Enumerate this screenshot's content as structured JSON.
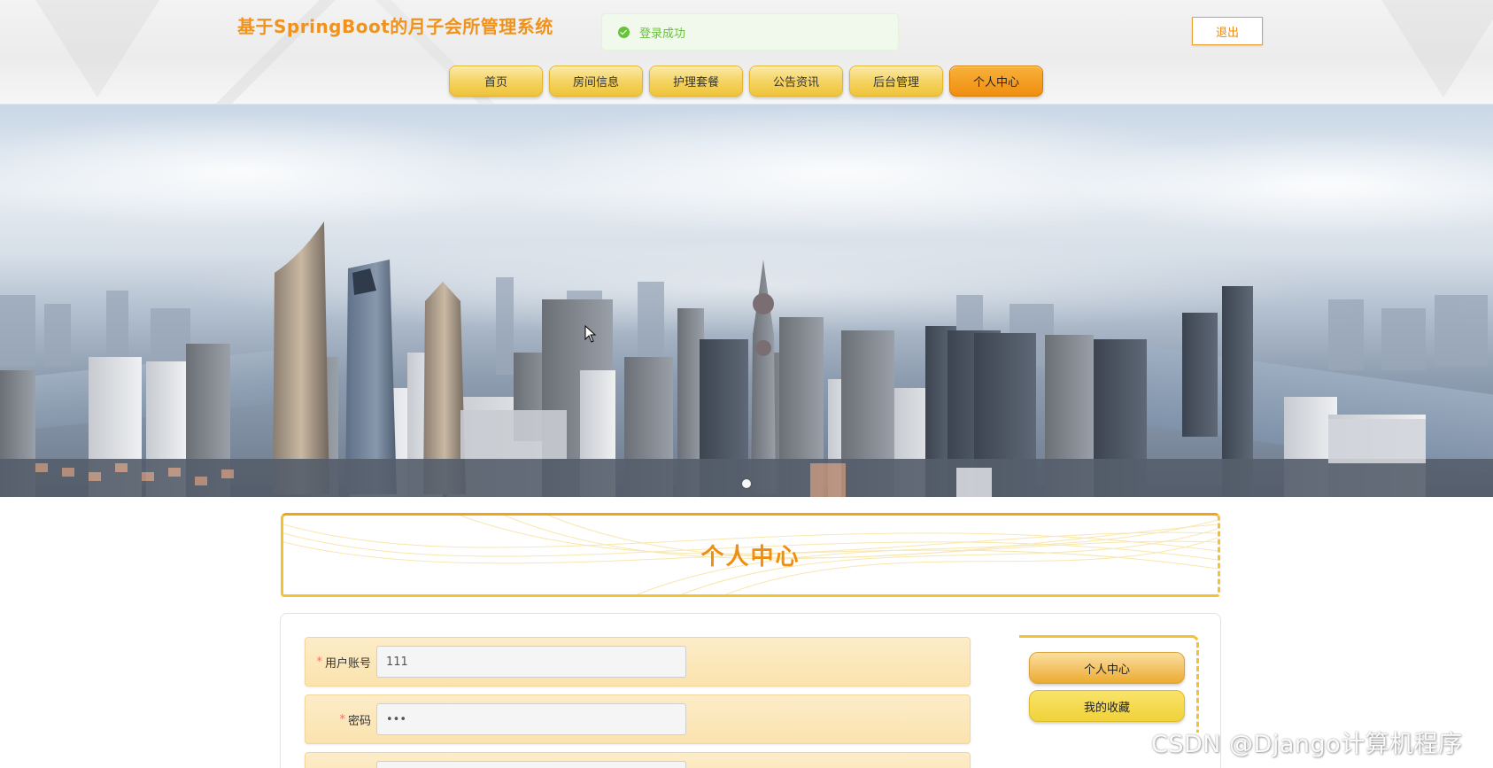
{
  "header": {
    "site_title": "基于SpringBoot的月子会所管理系统",
    "logout_label": "退出"
  },
  "toast": {
    "icon": "check-circle-icon",
    "message": "登录成功",
    "color": "#67c23a"
  },
  "nav": {
    "items": [
      {
        "label": "首页",
        "active": false
      },
      {
        "label": "房间信息",
        "active": false
      },
      {
        "label": "护理套餐",
        "active": false
      },
      {
        "label": "公告资讯",
        "active": false
      },
      {
        "label": "后台管理",
        "active": false
      },
      {
        "label": "个人中心",
        "active": true
      }
    ]
  },
  "banner": {
    "dots": 1
  },
  "section": {
    "title": "个人中心"
  },
  "form": {
    "fields": [
      {
        "label": "用户账号",
        "required": "*",
        "value": "111"
      },
      {
        "label": "密码",
        "required": "*",
        "value": "•••"
      }
    ]
  },
  "side_menu": {
    "items": [
      {
        "label": "个人中心",
        "active": true
      },
      {
        "label": "我的收藏",
        "active": false
      }
    ]
  },
  "watermark": "CSDN @Django计算机程序",
  "colors": {
    "accent": "#f08e10",
    "nav_gold": "#f4d25d",
    "nav_active": "#f08e10",
    "success": "#67c23a"
  }
}
